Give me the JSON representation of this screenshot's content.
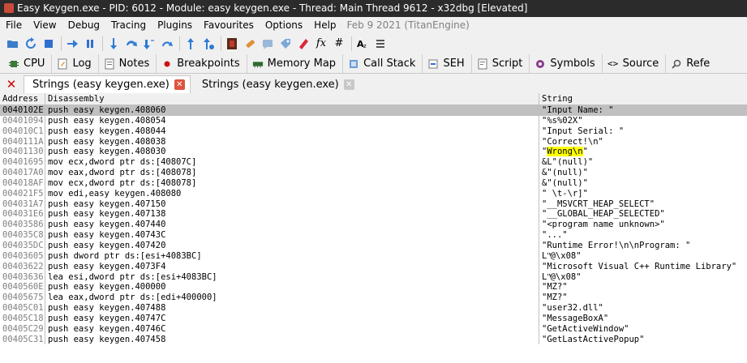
{
  "window": {
    "title": "Easy Keygen.exe - PID: 6012 - Module: easy keygen.exe - Thread: Main Thread 9612 - x32dbg [Elevated]"
  },
  "menu": {
    "items": [
      "File",
      "View",
      "Debug",
      "Tracing",
      "Plugins",
      "Favourites",
      "Options",
      "Help"
    ],
    "build_info": "Feb 9 2021 (TitanEngine)"
  },
  "toolbar": {
    "icons": [
      "open-icon",
      "restart-icon",
      "stop-icon",
      "run-icon",
      "pause-icon",
      "step-into-icon",
      "step-over-icon",
      "trace-into-icon",
      "trace-over-icon",
      "execute-till-return-icon",
      "run-to-user-code-icon",
      "scylla-icon",
      "patch-icon",
      "comment-icon",
      "label-icon",
      "bookmark-icon",
      "function-icon",
      "hash-icon",
      "font-icon",
      "list-icon"
    ],
    "glyph_fx": "fx",
    "glyph_hash": "#"
  },
  "view_tabs": [
    {
      "name": "cpu",
      "label": "CPU",
      "icon": "cpu-icon"
    },
    {
      "name": "log",
      "label": "Log",
      "icon": "log-icon"
    },
    {
      "name": "notes",
      "label": "Notes",
      "icon": "notes-icon"
    },
    {
      "name": "breakpoints",
      "label": "Breakpoints",
      "icon": "breakpoint-dot-icon",
      "accent": "#d01010"
    },
    {
      "name": "memory-map",
      "label": "Memory Map",
      "icon": "memory-map-icon"
    },
    {
      "name": "call-stack",
      "label": "Call Stack",
      "icon": "call-stack-icon"
    },
    {
      "name": "seh",
      "label": "SEH",
      "icon": "seh-icon"
    },
    {
      "name": "script",
      "label": "Script",
      "icon": "script-icon"
    },
    {
      "name": "symbols",
      "label": "Symbols",
      "icon": "symbols-icon"
    },
    {
      "name": "source",
      "label": "Source",
      "icon": "source-code-icon"
    },
    {
      "name": "references",
      "label": "Refe",
      "icon": "search-icon"
    }
  ],
  "doc_tabs": [
    {
      "label": "Strings (easy keygen.exe)",
      "active": true
    },
    {
      "label": "Strings (easy keygen.exe)",
      "active": false
    }
  ],
  "grid": {
    "headers": {
      "address": "Address",
      "disassembly": "Disassembly",
      "string": "String"
    },
    "highlight_color": "#ffff00",
    "selected_color": "#c0c0c0",
    "rows": [
      {
        "address": "0040102E",
        "disassembly": "push easy keygen.408060",
        "string": "\"Input Name: \"",
        "selected": true
      },
      {
        "address": "00401094",
        "disassembly": "push easy keygen.408054",
        "string": "\"%s%02X\""
      },
      {
        "address": "004010C1",
        "disassembly": "push easy keygen.408044",
        "string": "\"Input Serial: \""
      },
      {
        "address": "0040111A",
        "disassembly": "push easy keygen.408038",
        "string": "\"Correct!\\n\""
      },
      {
        "address": "00401130",
        "disassembly": "push easy keygen.408030",
        "string_pre": "\"",
        "string_hl": "Wrong\\n",
        "string_post": "\""
      },
      {
        "address": "00401695",
        "disassembly": "mov ecx,dword ptr ds:[40807C]",
        "string": "&L\"(null)\""
      },
      {
        "address": "004017A0",
        "disassembly": "mov eax,dword ptr ds:[408078]",
        "string": "&\"(null)\""
      },
      {
        "address": "004018AF",
        "disassembly": "mov ecx,dword ptr ds:[408078]",
        "string": "&\"(null)\""
      },
      {
        "address": "004021F5",
        "disassembly": "mov edi,easy keygen.408080",
        "string": "\" \\t-\\r]\""
      },
      {
        "address": "004031A7",
        "disassembly": "push easy keygen.407150",
        "string": "\"__MSVCRT_HEAP_SELECT\""
      },
      {
        "address": "004031E6",
        "disassembly": "push easy keygen.407138",
        "string": "\"__GLOBAL_HEAP_SELECTED\""
      },
      {
        "address": "00403586",
        "disassembly": "push easy keygen.407440",
        "string": "\"<program name unknown>\""
      },
      {
        "address": "004035C8",
        "disassembly": "push easy keygen.40743C",
        "string": "\"...\""
      },
      {
        "address": "004035DC",
        "disassembly": "push easy keygen.407420",
        "string": "\"Runtime Error!\\n\\nProgram: \""
      },
      {
        "address": "00403605",
        "disassembly": "push dword ptr ds:[esi+4083BC]",
        "string": "L\"ͬ@\\x08\""
      },
      {
        "address": "00403622",
        "disassembly": "push easy keygen.4073F4",
        "string": "\"Microsoft Visual C++ Runtime Library\""
      },
      {
        "address": "00403636",
        "disassembly": "lea esi,dword ptr ds:[esi+4083BC]",
        "string": "L\"ͬ@\\x08\""
      },
      {
        "address": "0040560E",
        "disassembly": "push easy keygen.400000",
        "string": "\"MZ?\""
      },
      {
        "address": "00405675",
        "disassembly": "lea eax,dword ptr ds:[edi+400000]",
        "string": "\"MZ?\""
      },
      {
        "address": "00405C01",
        "disassembly": "push easy keygen.407488",
        "string": "\"user32.dll\""
      },
      {
        "address": "00405C18",
        "disassembly": "push easy keygen.40747C",
        "string": "\"MessageBoxA\""
      },
      {
        "address": "00405C29",
        "disassembly": "push easy keygen.40746C",
        "string": "\"GetActiveWindow\""
      },
      {
        "address": "00405C31",
        "disassembly": "push easy keygen.407458",
        "string": "\"GetLastActivePopup\""
      }
    ]
  }
}
